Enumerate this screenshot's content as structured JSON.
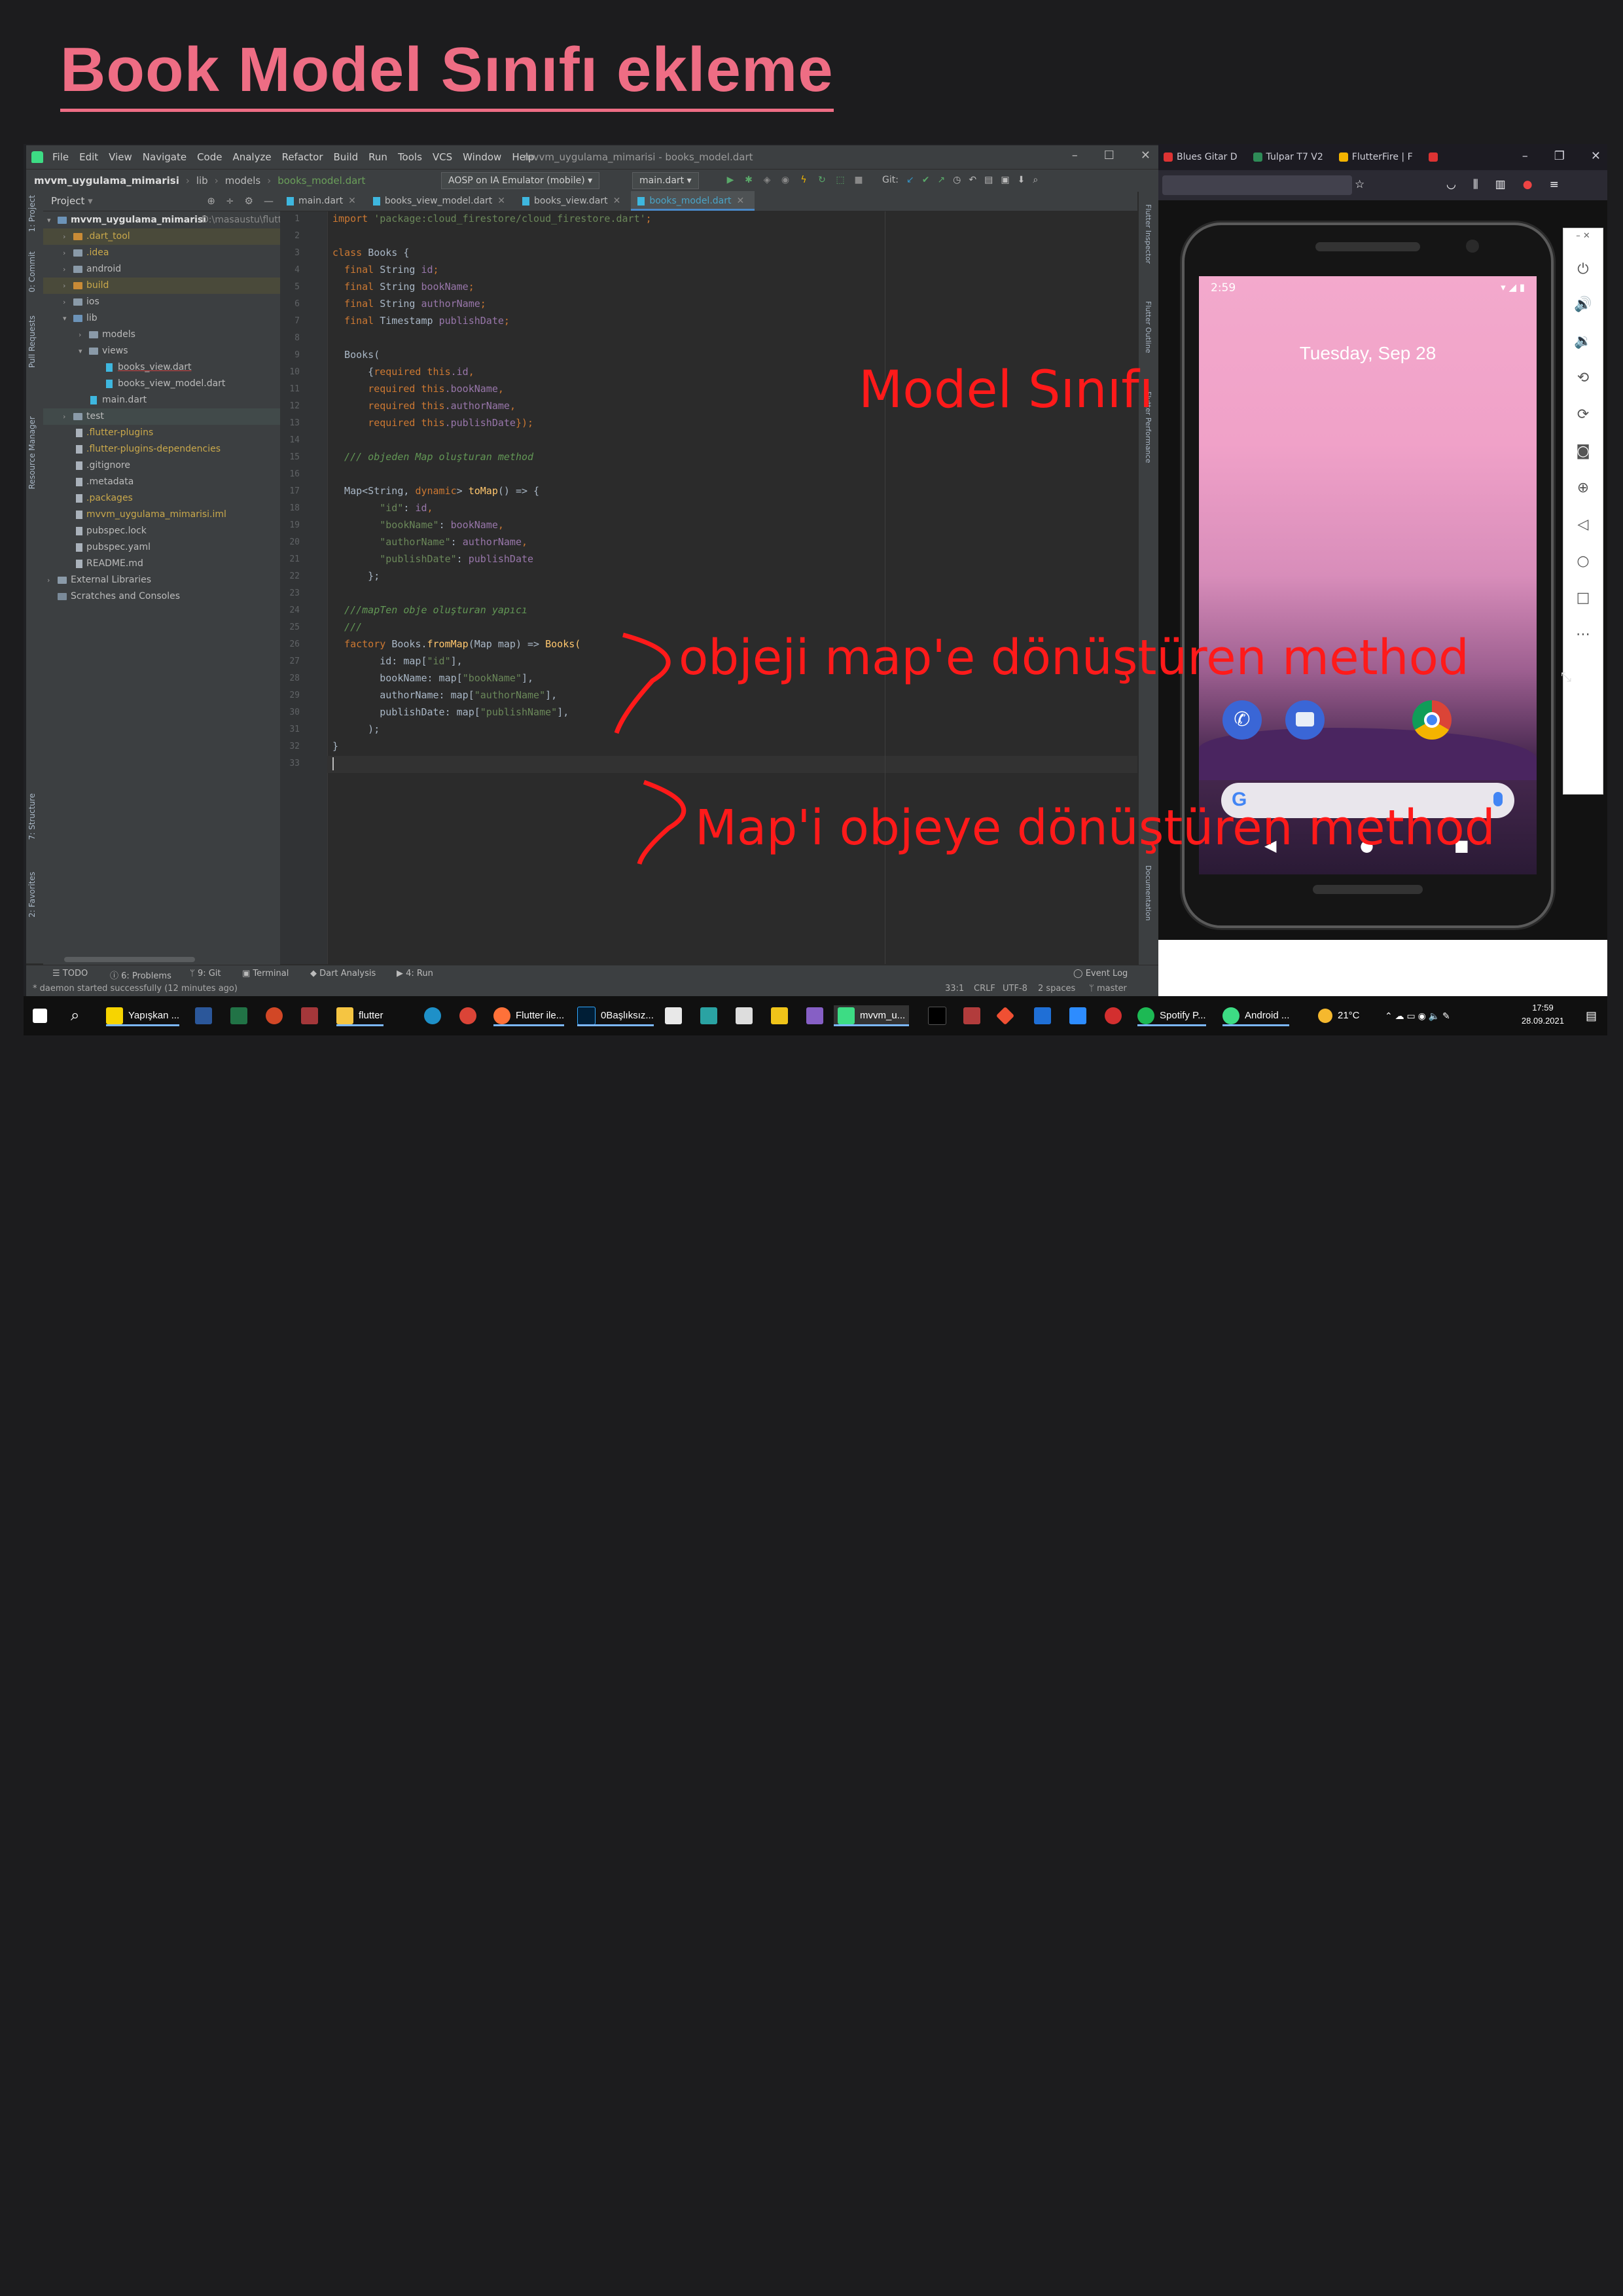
{
  "slide": {
    "title": "Book Model Sınıfı ekleme"
  },
  "ide": {
    "menu": [
      "File",
      "Edit",
      "View",
      "Navigate",
      "Code",
      "Analyze",
      "Refactor",
      "Build",
      "Run",
      "Tools",
      "VCS",
      "Window",
      "Help"
    ],
    "window_title": "mvvm_uygulama_mimarisi - books_model.dart",
    "breadcrumbs": {
      "project": "mvvm_uygulama_mimarisi",
      "lib": "lib",
      "models": "models",
      "file": "books_model.dart"
    },
    "run_config": "AOSP on IA Emulator (mobile)",
    "main_config": "main.dart",
    "git_label": "Git:",
    "project_panel": {
      "title": "Project",
      "items": [
        {
          "label": "mvvm_uygulama_mimarisi",
          "hint": "D:\\masaustu\\flutt"
        },
        {
          "label": ".dart_tool"
        },
        {
          "label": ".idea"
        },
        {
          "label": "android"
        },
        {
          "label": "build"
        },
        {
          "label": "ios"
        },
        {
          "label": "lib"
        },
        {
          "label": "models"
        },
        {
          "label": "views"
        },
        {
          "label": "books_view.dart"
        },
        {
          "label": "books_view_model.dart"
        },
        {
          "label": "main.dart"
        },
        {
          "label": "test"
        },
        {
          "label": ".flutter-plugins"
        },
        {
          "label": ".flutter-plugins-dependencies"
        },
        {
          "label": ".gitignore"
        },
        {
          "label": ".metadata"
        },
        {
          "label": ".packages"
        },
        {
          "label": "mvvm_uygulama_mimarisi.iml"
        },
        {
          "label": "pubspec.lock"
        },
        {
          "label": "pubspec.yaml"
        },
        {
          "label": "README.md"
        },
        {
          "label": "External Libraries"
        },
        {
          "label": "Scratches and Consoles"
        }
      ]
    },
    "left_tabs": [
      "1: Project",
      "0: Commit",
      "Pull Requests",
      "Resource Manager",
      "7: Structure",
      "2: Favorites"
    ],
    "right_tabs": [
      "Flutter Inspector",
      "Flutter Outline",
      "Flutter Performance",
      "Documentation"
    ],
    "tabs": [
      {
        "label": "main.dart"
      },
      {
        "label": "books_view_model.dart"
      },
      {
        "label": "books_view.dart"
      },
      {
        "label": "books_model.dart"
      }
    ],
    "line_numbers": [
      "1",
      "2",
      "3",
      "4",
      "5",
      "6",
      "7",
      "8",
      "9",
      "10",
      "11",
      "12",
      "13",
      "14",
      "15",
      "16",
      "17",
      "18",
      "19",
      "20",
      "21",
      "22",
      "23",
      "24",
      "25",
      "26",
      "27",
      "28",
      "29",
      "30",
      "31",
      "32",
      "33"
    ],
    "code": {
      "l1a": "import ",
      "l1b": "'package:cloud_firestore/cloud_firestore.dart'",
      "l1c": ";",
      "l3a": "class ",
      "l3b": "Books {",
      "l4a": "  final ",
      "l4b": "String ",
      "l4c": "id",
      "l4d": ";",
      "l5a": "  final ",
      "l5b": "String ",
      "l5c": "bookName",
      "l5d": ";",
      "l6a": "  final ",
      "l6b": "String ",
      "l6c": "authorName",
      "l6d": ";",
      "l7a": "  final ",
      "l7b": "Timestamp ",
      "l7c": "publishDate",
      "l7d": ";",
      "l9": "  Books(",
      "l10a": "      {",
      "l10b": "required this",
      "l10c": ".id",
      "l10d": ",",
      "l11a": "      ",
      "l11b": "required this",
      "l11c": ".bookName",
      "l11d": ",",
      "l12a": "      ",
      "l12b": "required this",
      "l12c": ".authorName",
      "l12d": ",",
      "l13a": "      ",
      "l13b": "required this",
      "l13c": ".publishDate",
      "l13d": "});",
      "l15": "  /// objeden Map oluşturan method",
      "l17a": "  Map<String, ",
      "l17b": "dynamic",
      "l17c": "> ",
      "l17d": "toMap",
      "l17e": "() => {",
      "l18a": "        ",
      "l18b": "\"id\"",
      "l18c": ": ",
      "l18d": "id",
      "l18e": ",",
      "l19a": "        ",
      "l19b": "\"bookName\"",
      "l19c": ": ",
      "l19d": "bookName",
      "l19e": ",",
      "l20a": "        ",
      "l20b": "\"authorName\"",
      "l20c": ": ",
      "l20d": "authorName",
      "l20e": ",",
      "l21a": "        ",
      "l21b": "\"publishDate\"",
      "l21c": ": ",
      "l21d": "publishDate",
      "l22": "      };",
      "l24": "  ///mapTen obje oluşturan yapıcı",
      "l25": "  ///",
      "l26a": "  factory ",
      "l26b": "Books.",
      "l26c": "fromMap",
      "l26d": "(Map map) => ",
      "l26e": "Books(",
      "l27a": "        id: map[",
      "l27b": "\"id\"",
      "l27c": "],",
      "l28a": "        bookName: map[",
      "l28b": "\"bookName\"",
      "l28c": "],",
      "l29a": "        authorName: map[",
      "l29b": "\"authorName\"",
      "l29c": "],",
      "l30a": "        publishDate: map[",
      "l30b": "\"publishName\"",
      "l30c": "],",
      "l31": "      );",
      "l32": "}"
    },
    "bottom_tabs": [
      "TODO",
      "6: Problems",
      "9: Git",
      "Terminal",
      "Dart Analysis",
      "4: Run",
      "Event Log"
    ],
    "status": {
      "message": "* daemon started successfully (12 minutes ago)",
      "position": "33:1",
      "line_sep": "CRLF",
      "encoding": "UTF-8",
      "indent": "2 spaces",
      "branch": "master"
    }
  },
  "browser": {
    "tabs": [
      "Blues Gitar D",
      "Tulpar T7 V2",
      "FlutterFire | F"
    ]
  },
  "emulator": {
    "time": "2:59",
    "date": "Tuesday, Sep 28"
  },
  "taskbar": {
    "items": [
      "Yapışkan ...",
      "flutter",
      "Flutter ile...",
      "0Başlıksız...",
      "mvvm_u...",
      "Spotify P...",
      "Android ..."
    ],
    "weather": "21°C",
    "time": "17:59",
    "date": "28.09.2021"
  },
  "annotations": {
    "model": "Model Sınıfı",
    "tomap": "objeji map'e dönüştüren method",
    "frommap": "Map'i objeye dönüştüren method"
  },
  "colors": {
    "title": "#ee6d84",
    "annotation": "#ff1a1a",
    "ide_bg": "#2b2b2b"
  }
}
